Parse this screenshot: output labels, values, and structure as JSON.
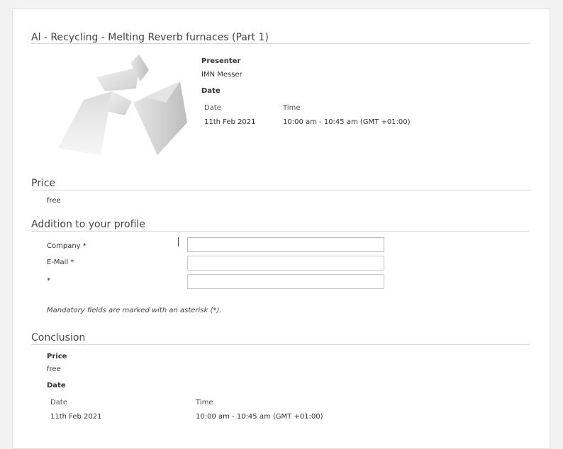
{
  "event": {
    "title": "Al - Recycling - Melting Reverb furnaces (Part 1)",
    "presenter_heading": "Presenter",
    "presenter_name": "IMN Messer",
    "date_heading": "Date",
    "date_col_label": "Date",
    "time_col_label": "Time",
    "date_value": "11th Feb 2021",
    "time_value": "10:00 am - 10:45 am (GMT +01:00)"
  },
  "price": {
    "heading": "Price",
    "value": "free"
  },
  "profile": {
    "heading": "Addition to your profile",
    "fields": [
      {
        "label": "Company *",
        "value": ""
      },
      {
        "label": "E-Mail *",
        "value": ""
      },
      {
        "label": "*",
        "value": ""
      }
    ],
    "note": "Mandatory fields are marked with an asterisk (*)."
  },
  "conclusion": {
    "heading": "Conclusion",
    "price_heading": "Price",
    "price_value": "free",
    "date_heading": "Date",
    "date_col_label": "Date",
    "time_col_label": "Time",
    "date_value": "11th Feb 2021",
    "time_value": "10:00 am - 10:45 am (GMT +01:00)"
  },
  "colors": {
    "background": "#f2f2f2",
    "card": "#ffffff",
    "rule": "#d9d9d9"
  }
}
